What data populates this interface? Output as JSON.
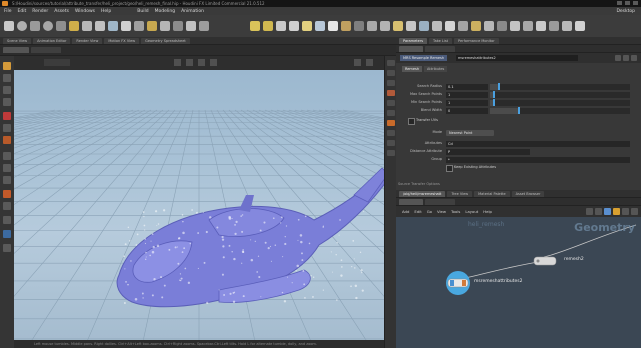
{
  "window": {
    "title": "S:/Houdini/sources/tutorial/attribute_transfer/heli_project/geo/heli_remesh_final.hip - Houdini FX Limited Commercial 21.0.512"
  },
  "menubar": {
    "items": [
      "File",
      "Edit",
      "Render",
      "Assets",
      "Windows",
      "Help",
      "Build",
      "Modeling",
      "Animation",
      "Desktop"
    ]
  },
  "viewport": {
    "tabs": [
      "Scene View",
      "Animation Editor",
      "Render View",
      "Motion FX View",
      "Geometry Spreadsheet"
    ],
    "status": "Left mouse tumbles. Middle pans. Right dollies. Ctrl+Alt+Left box-zooms. Ctrl+Right zooms. Spacebar-Ctrl-Left tilts. Hold L for alternate tumble, dolly, and zoom."
  },
  "parameters": {
    "tabs": [
      "Parameters",
      "Take List",
      "Performance Monitor"
    ],
    "node_type": "MRS Resample Remesh",
    "node_name": "msremeshattributes2",
    "section_tabs": [
      "Remesh",
      "Attributes"
    ],
    "rows": [
      {
        "label": "Search Radius",
        "value": "0.1",
        "fill": 0.06
      },
      {
        "label": "Max Search Points",
        "value": "1",
        "fill": 0.02
      },
      {
        "label": "Min Search Points",
        "value": "1",
        "fill": 0.02
      },
      {
        "label": "Blend Width",
        "value": "0",
        "fill": 0.2
      }
    ],
    "uv_checkbox": "Transfer UVs",
    "mode_label": "Mode",
    "mode_value": "Nearest Point",
    "attribute_label": "Attributes",
    "attribute_value": "Cd",
    "distance_label": "Distance Attribute",
    "distance_value": "P",
    "attr_group_label": "Group",
    "attr_group_value": "*",
    "keep_checkbox": "Keep Existing Attributes",
    "section_label": "Source Transfer Options"
  },
  "network": {
    "tabs": [
      "/obj/heli/msremeshatt",
      "Tree View",
      "Material Palette",
      "Asset Browser"
    ],
    "menu": [
      "Add",
      "Edit",
      "Go",
      "View",
      "Tools",
      "Layout",
      "Help"
    ],
    "context_label": "Geometry",
    "path_label": "heli_remesh",
    "nodes": [
      {
        "name": "remesh2"
      },
      {
        "name": "msremeshattributes2"
      }
    ]
  }
}
